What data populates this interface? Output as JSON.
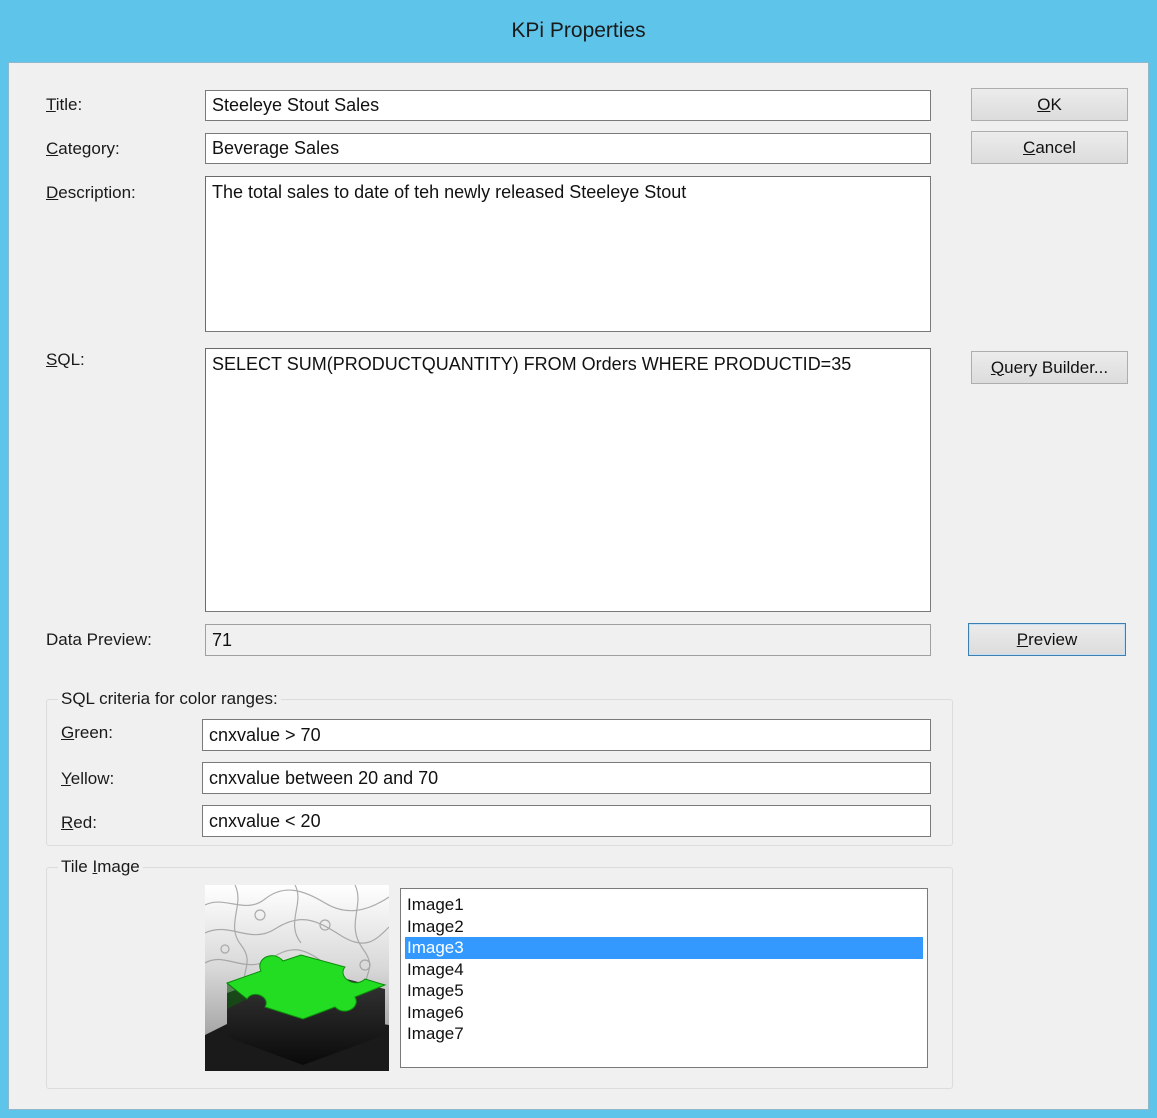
{
  "window": {
    "title": "KPi Properties"
  },
  "form": {
    "title_label": "Title:",
    "title_value": "Steeleye Stout Sales",
    "category_label": "Category:",
    "category_value": "Beverage Sales",
    "description_label": "Description:",
    "description_value": "The total sales to date of teh newly released Steeleye Stout",
    "sql_label": "SQL:",
    "sql_value": "SELECT SUM(PRODUCTQUANTITY) FROM Orders WHERE PRODUCTID=35",
    "data_preview_label": "Data Preview:",
    "data_preview_value": "71"
  },
  "buttons": {
    "ok": "OK",
    "cancel": "Cancel",
    "query_builder": "Query Builder...",
    "preview": "Preview"
  },
  "color_ranges": {
    "group_label": "SQL criteria for color ranges:",
    "green_label": "Green:",
    "green_value": "cnxvalue > 70",
    "yellow_label": "Yellow:",
    "yellow_value": "cnxvalue between 20 and 70",
    "red_label": "Red:",
    "red_value": "cnxvalue < 20"
  },
  "tile_image": {
    "group_label": "Tile Image",
    "items": [
      "Image1",
      "Image2",
      "Image3",
      "Image4",
      "Image5",
      "Image6",
      "Image7"
    ],
    "selected": "Image3",
    "preview_icon": "green-puzzle-piece-icon"
  },
  "colors": {
    "titlebar": "#5ec4ea",
    "selection": "#3399ff",
    "puzzle_green": "#22dd22"
  }
}
